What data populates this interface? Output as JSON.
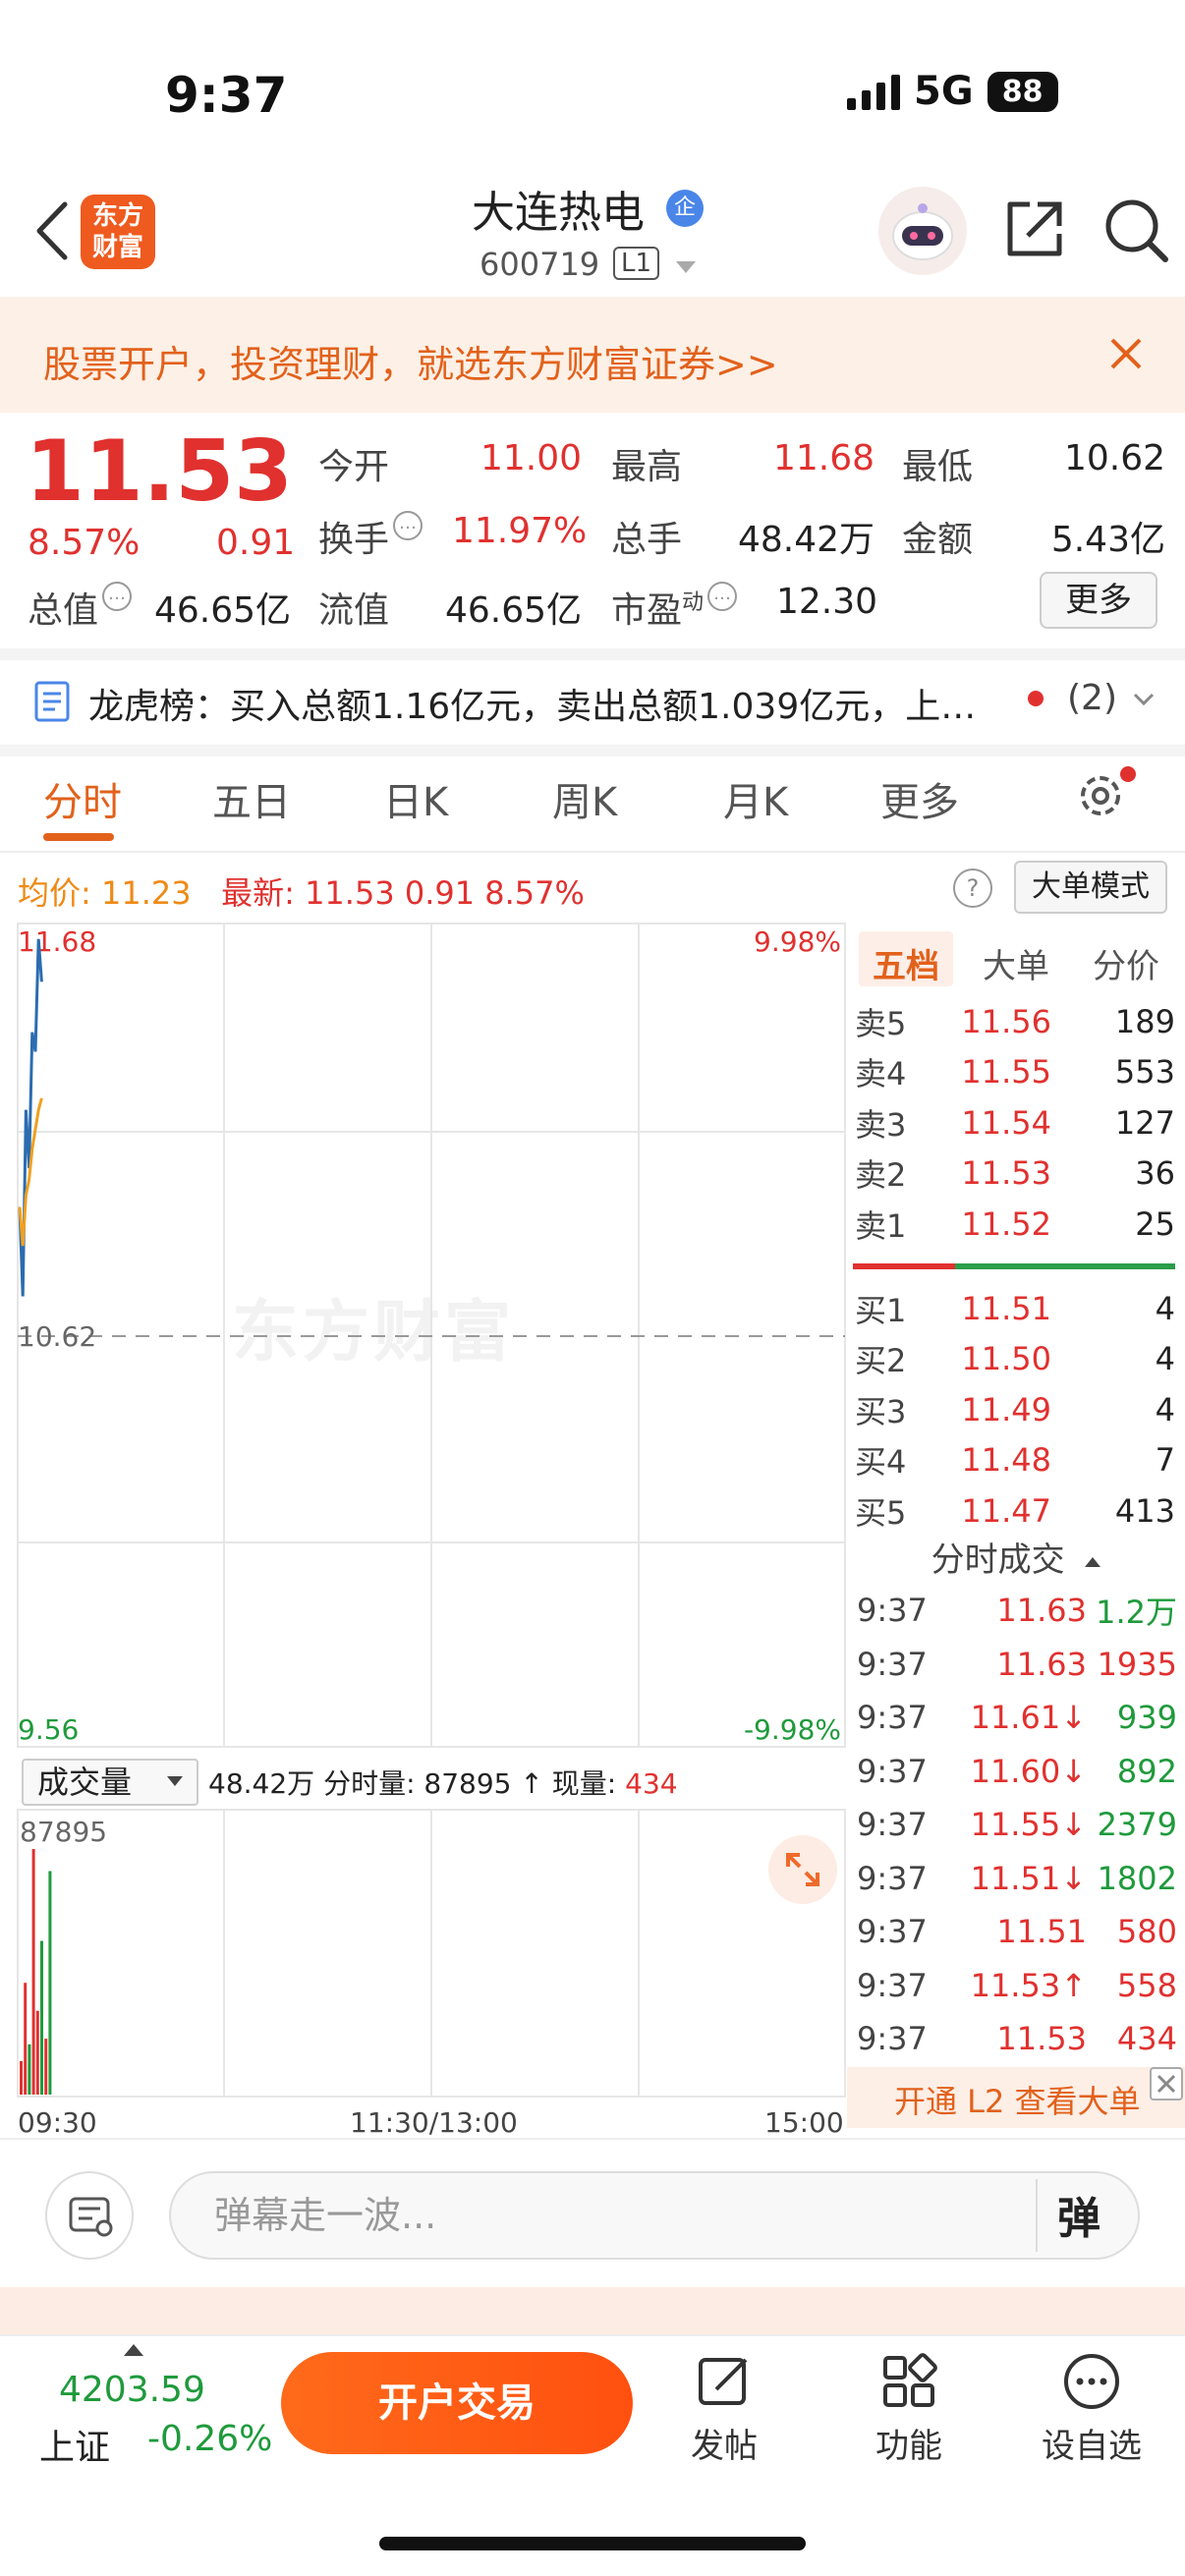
{
  "status_bar": {
    "time": "9:37",
    "network": "5G",
    "battery": "88"
  },
  "header": {
    "logo_text": [
      "东方",
      "财富"
    ],
    "stock_name": "大连热电",
    "badge": "企",
    "stock_code": "600719",
    "market_level": "L1"
  },
  "promo": {
    "text": "股票开户，投资理财，就选东方财富证券>>"
  },
  "quote": {
    "price": "11.53",
    "change_pct": "8.57%",
    "change": "0.91",
    "fields": {
      "open_label": "今开",
      "open": "11.00",
      "high_label": "最高",
      "high": "11.68",
      "low_label": "最低",
      "low": "10.62",
      "turnover_label": "换手",
      "turnover": "11.97%",
      "volume_label": "总手",
      "volume": "48.42万",
      "amount_label": "金额",
      "amount": "5.43亿",
      "mktcap_label": "总值",
      "mktcap": "46.65亿",
      "float_label": "流值",
      "float": "46.65亿",
      "pe_label": "市盈",
      "pe_sup": "动",
      "pe": "12.30"
    },
    "more_label": "更多"
  },
  "dragon_tiger": {
    "text": "龙虎榜：买入总额1.16亿元，卖出总额1.039亿元，上…",
    "count": "(2)"
  },
  "chart_tabs": [
    "分时",
    "五日",
    "日K",
    "周K",
    "月K",
    "更多"
  ],
  "avg_row": {
    "avg_label": "均价:",
    "avg_value": "11.23",
    "latest_label": "最新:",
    "latest_value": "11.53",
    "latest_change": "0.91",
    "latest_pct": "8.57%",
    "help": "?",
    "big_order_mode": "大单模式"
  },
  "watermark": "东方财富",
  "chart_data": [
    {
      "type": "line",
      "series": [
        {
          "name": "",
          "color": "#2b6cb0",
          "x": [
            0,
            1,
            2,
            3,
            4,
            5,
            6,
            7
          ],
          "y": [
            10.95,
            10.72,
            11.2,
            11.05,
            11.4,
            11.35,
            11.64,
            11.53
          ]
        },
        {
          "name": "",
          "color": "#f0a020",
          "x": [
            0,
            1,
            2,
            3,
            4,
            5,
            6,
            7
          ],
          "y": [
            10.95,
            10.85,
            10.98,
            11.02,
            11.1,
            11.15,
            11.2,
            11.23
          ]
        }
      ],
      "ylim": [
        9.56,
        11.68
      ],
      "baseline": 10.62,
      "y_left_labels": {
        "top": "11.68",
        "mid": "10.62",
        "bottom": "9.56"
      },
      "y_right_labels": {
        "top": "9.98%",
        "bottom": "-9.98%"
      },
      "x_labels": [
        "09:30",
        "11:30/13:00",
        "15:00"
      ],
      "grid": true
    },
    {
      "type": "bar",
      "title": "成交量",
      "max_label": "87895",
      "values": [
        12000,
        40000,
        18000,
        87895,
        30000,
        55000,
        20000,
        80000
      ],
      "colors": [
        "#e0312f",
        "#e0312f",
        "#1f9a3c",
        "#e0312f",
        "#e0312f",
        "#1f9a3c",
        "#e0312f",
        "#1f9a3c"
      ],
      "ylim": [
        0,
        87895
      ]
    }
  ],
  "volume_row": {
    "selector": "成交量",
    "total": "48.42万",
    "minute_label": "分时量:",
    "minute_value": "87895",
    "arrow": "↑",
    "current_label": "现量:",
    "current_value": "434"
  },
  "panel": {
    "tabs": [
      "五档",
      "大单",
      "分价"
    ],
    "asks": [
      {
        "side": "卖5",
        "price": "11.56",
        "vol": "189"
      },
      {
        "side": "卖4",
        "price": "11.55",
        "vol": "553"
      },
      {
        "side": "卖3",
        "price": "11.54",
        "vol": "127"
      },
      {
        "side": "卖2",
        "price": "11.53",
        "vol": "36"
      },
      {
        "side": "卖1",
        "price": "11.52",
        "vol": "25"
      }
    ],
    "bids": [
      {
        "side": "买1",
        "price": "11.51",
        "vol": "4"
      },
      {
        "side": "买2",
        "price": "11.50",
        "vol": "4"
      },
      {
        "side": "买3",
        "price": "11.49",
        "vol": "4"
      },
      {
        "side": "买4",
        "price": "11.48",
        "vol": "7"
      },
      {
        "side": "买5",
        "price": "11.47",
        "vol": "413"
      }
    ],
    "ticks_header": "分时成交",
    "ticks": [
      {
        "time": "9:37",
        "price": "11.63",
        "vol": "1.2万",
        "dir": "g"
      },
      {
        "time": "9:37",
        "price": "11.63",
        "vol": "1935",
        "dir": "r"
      },
      {
        "time": "9:37",
        "price": "11.61↓",
        "vol": "939",
        "dir": "g"
      },
      {
        "time": "9:37",
        "price": "11.60↓",
        "vol": "892",
        "dir": "g"
      },
      {
        "time": "9:37",
        "price": "11.55↓",
        "vol": "2379",
        "dir": "g"
      },
      {
        "time": "9:37",
        "price": "11.51↓",
        "vol": "1802",
        "dir": "g"
      },
      {
        "time": "9:37",
        "price": "11.51",
        "vol": "580",
        "dir": "r"
      },
      {
        "time": "9:37",
        "price": "11.53↑",
        "vol": "558",
        "dir": "r"
      },
      {
        "time": "9:37",
        "price": "11.53",
        "vol": "434",
        "dir": "r"
      }
    ],
    "l2_banner": "开通 L2 查看大单"
  },
  "comment": {
    "placeholder": "弹幕走一波...",
    "toggle": "弹"
  },
  "bottom_bar": {
    "index_value": "4203.59",
    "index_name": "上证",
    "index_pct": "-0.26%",
    "trade_button": "开户交易",
    "nav": [
      "发帖",
      "功能",
      "设自选"
    ]
  },
  "colors": {
    "up": "#e0312f",
    "down": "#1f9a3c",
    "accent": "#ee5a1a",
    "avg": "#f0a020",
    "price_line": "#2b6cb0"
  }
}
